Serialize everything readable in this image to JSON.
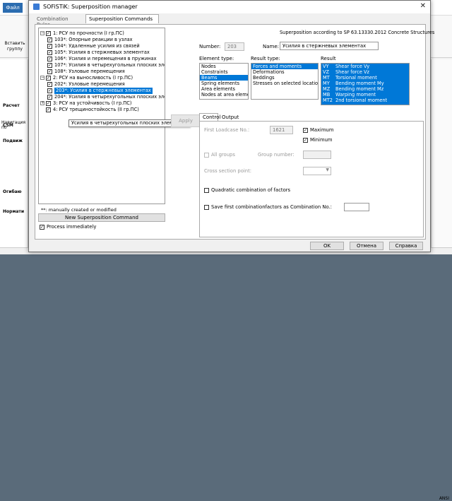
{
  "background": {
    "file_tab": "Файл",
    "ribbon_button": "Вставить группу",
    "nav_title": "Навигация по",
    "nav_labels": [
      "Расчет",
      "CSM",
      "Подвиж",
      "Огибаю",
      "Нормати"
    ],
    "status_right": "ANSI"
  },
  "dialog": {
    "title": "SOFiSTiK: Superposition manager",
    "tabs": [
      "Combination Rules",
      "Superposition Commands"
    ],
    "active_tab": 1,
    "sp_label": "Superposition according to SP 63.13330.2012 Concrete Structures"
  },
  "tree": {
    "nodes": [
      {
        "text": "1: РСУ по прочности (I гр.ПС)",
        "level": 0,
        "expander": "−",
        "checked": true
      },
      {
        "text": "103*: Опорные реакции в узлах",
        "level": 1,
        "checked": true
      },
      {
        "text": "104*: Удаленные усилия из связей",
        "level": 1,
        "checked": true
      },
      {
        "text": "105*: Усилия в стержневых элементах",
        "level": 1,
        "checked": true
      },
      {
        "text": "106*: Усилия и перемещения в пружинах",
        "level": 1,
        "checked": true
      },
      {
        "text": "107*: Усилия в четырехугольных плоских элементах",
        "level": 1,
        "checked": true
      },
      {
        "text": "108*: Узловые перемещения",
        "level": 1,
        "checked": true
      },
      {
        "text": "2: РСУ на выносливость (I гр.ПС)",
        "level": 0,
        "expander": "−",
        "checked": true
      },
      {
        "text": "202*: Узловые перемещения",
        "level": 1,
        "checked": true
      },
      {
        "text": "203*: Усилия в стержневых элементах",
        "level": 1,
        "checked": true,
        "selected": true
      },
      {
        "text": "204*: Усилия в четырехугольных плоских элементах",
        "level": 1,
        "checked": true
      },
      {
        "text": "3: РСУ на устойчивость (I гр.ПС)",
        "level": 0,
        "expander": "+",
        "checked": true
      },
      {
        "text": "4: РСУ трещиностойкость (II гр.ПС)",
        "level": 0,
        "expander": "",
        "checked": true
      }
    ],
    "tooltip": "Усилия в четырехугольных плоских элементах",
    "note": "**: manually created or modified",
    "new_command_button": "New Superposition Command",
    "process_immediately": "Process immediately",
    "process_checked": true
  },
  "form": {
    "number_label": "Number:",
    "number_value": "203",
    "name_label": "Name:",
    "name_value": "Усилия в стержневых элементах",
    "element_type_label": "Element type:",
    "element_types": [
      "Nodes",
      "Constraints",
      "Beams",
      "Spring elements",
      "Area elements",
      "Nodes at area element"
    ],
    "element_type_selected": 2,
    "result_type_label": "Result type:",
    "result_types": [
      "Forces and moments",
      "Deformations",
      "Beddings",
      "Stresses on selected locations"
    ],
    "result_type_selected": 0,
    "result_label": "Result",
    "results": [
      {
        "code": "VY",
        "desc": "Shear force Vy"
      },
      {
        "code": "VZ",
        "desc": "Shear force Vz"
      },
      {
        "code": "MT",
        "desc": "Torsional moment"
      },
      {
        "code": "MY",
        "desc": "Bending moment My"
      },
      {
        "code": "MZ",
        "desc": "Bending moment Mz"
      },
      {
        "code": "MB",
        "desc": "Warping moment"
      },
      {
        "code": "MT2",
        "desc": "2nd torsional moment"
      }
    ],
    "apply_button": "Apply"
  },
  "control": {
    "tabs": [
      "Control",
      "Output"
    ],
    "first_loadcase_label": "First Loadcase No.:",
    "first_loadcase_value": "1621",
    "maximum_label": "Maximum",
    "maximum_checked": true,
    "minimum_label": "Minimum",
    "minimum_checked": true,
    "all_groups_label": "All groups",
    "group_number_label": "Group number:",
    "cross_section_label": "Cross section point:",
    "quadratic_label": "Quadratic combination of factors",
    "save_first_label": "Save first combinationfactors as Combination No.:"
  },
  "footer": {
    "ok": "OK",
    "cancel": "Отмена",
    "help": "Справка"
  }
}
